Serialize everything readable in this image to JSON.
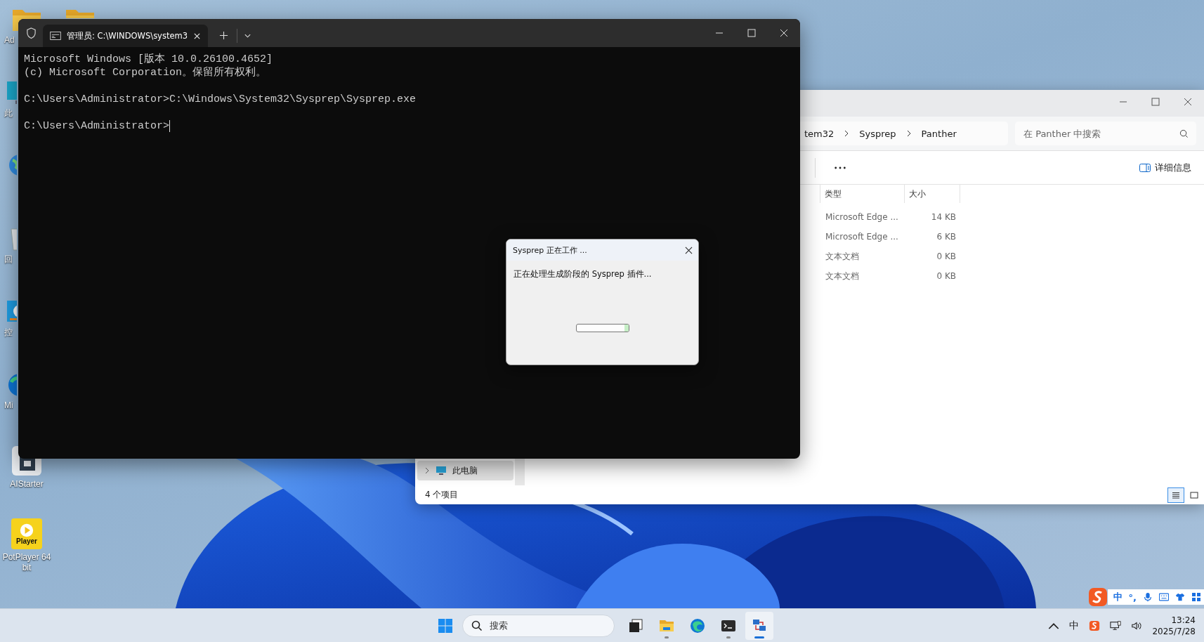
{
  "desktop_icons": [
    {
      "kind": "folder",
      "label": "Ad"
    },
    {
      "kind": "pc",
      "label": "此"
    },
    {
      "kind": "globe"
    },
    {
      "kind": "recycle",
      "label": "回"
    },
    {
      "kind": "control",
      "label": "控"
    },
    {
      "kind": "edge",
      "label": "Mi"
    },
    {
      "kind": "aistarter",
      "label": "AIStarter"
    },
    {
      "kind": "potplayer",
      "label": "PotPlayer 64 bit",
      "badge": "Player"
    },
    {
      "kind": "folder"
    }
  ],
  "terminal": {
    "tab_title": "管理员: C:\\WINDOWS\\system3",
    "output_blocks": [
      [
        "Microsoft Windows [版本 10.0.26100.4652]",
        "(c) Microsoft Corporation。保留所有权利。"
      ],
      [
        "C:\\Users\\Administrator>C:\\Windows\\System32\\Sysprep\\Sysprep.exe"
      ],
      [
        "C:\\Users\\Administrator>"
      ]
    ],
    "cursor_visible": true
  },
  "explorer": {
    "breadcrumbs": [
      "tem32",
      "Sysprep",
      "Panther"
    ],
    "search": {
      "placeholder": "在 Panther 中搜索"
    },
    "details_label": "详细信息",
    "columns": [
      "类型",
      "大小"
    ],
    "rows": [
      {
        "type": "Microsoft Edge ...",
        "size": "14 KB"
      },
      {
        "type": "Microsoft Edge ...",
        "size": "6 KB"
      },
      {
        "type": "文本文档",
        "size": "0 KB"
      },
      {
        "type": "文本文档",
        "size": "0 KB"
      }
    ],
    "nav_items": [
      {
        "label": "此电脑",
        "selected": true,
        "expanded": false
      }
    ],
    "status": "4 个项目",
    "views": [
      {
        "kind": "details",
        "selected": true
      },
      {
        "kind": "tiles",
        "selected": false
      }
    ]
  },
  "dialog": {
    "title": "Sysprep 正在工作 ...",
    "message": "正在处理生成阶段的 Sysprep 插件...",
    "progress": {
      "level": 0.08
    }
  },
  "ime_toolbar": {
    "mode": "中",
    "punctuation": "°,"
  },
  "taskbar": {
    "search": {
      "placeholder": "搜索"
    },
    "apps": [
      {
        "kind": "taskview",
        "running": false,
        "active": false
      },
      {
        "kind": "explorer",
        "running": true,
        "active": false
      },
      {
        "kind": "edge",
        "running": false,
        "active": false
      },
      {
        "kind": "terminal",
        "running": true,
        "active": false
      },
      {
        "kind": "network",
        "running": true,
        "active": true
      }
    ],
    "tray": {
      "ime_label": "中",
      "clock_time": "13:24",
      "clock_date": "2025/7/28"
    }
  }
}
